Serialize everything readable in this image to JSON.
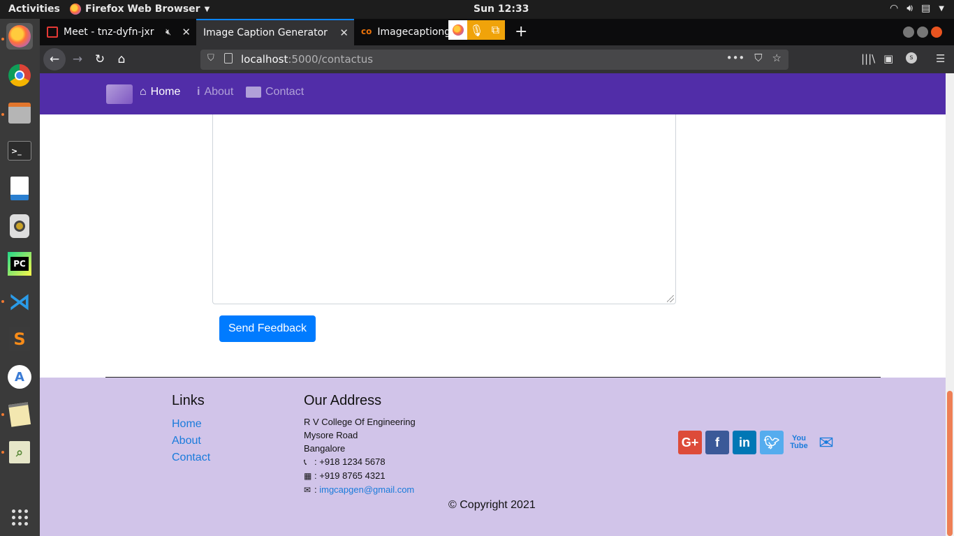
{
  "system": {
    "activities": "Activities",
    "app_menu": "Firefox Web Browser",
    "clock": "Sun 12:33"
  },
  "dock": {
    "items": [
      "firefox",
      "chrome",
      "files",
      "terminal",
      "libreoffice-writer",
      "rhythmbox",
      "pycharm",
      "vscode",
      "sublime-text",
      "android-studio",
      "text-editor",
      "gedit-tool",
      "show-applications"
    ],
    "pycharm_label": "PC"
  },
  "browser": {
    "tabs": [
      {
        "label": "Meet - tnz-dyfn-jxr"
      },
      {
        "label": "Image Caption Generator"
      },
      {
        "label": "Imagecaptionge"
      }
    ],
    "url_host": "localhost",
    "url_path": ":5000/contactus"
  },
  "site": {
    "nav": {
      "home": "Home",
      "about": "About",
      "contact": "Contact"
    },
    "send_button": "Send Feedback",
    "footer": {
      "links_heading": "Links",
      "links": [
        "Home",
        "About",
        "Contact"
      ],
      "address_heading": "Our Address",
      "address_lines": [
        "R V College Of Engineering",
        "Mysore Road",
        "Bangalore"
      ],
      "phone": ": +918 1234 5678",
      "fax": ": +919 8765 4321",
      "email_prefix": ": ",
      "email": "imgcapgen@gmail.com",
      "copyright": "© Copyright 2021",
      "social_icons": [
        "google-plus-icon",
        "facebook-icon",
        "linkedin-icon",
        "twitter-icon",
        "youtube-icon",
        "email-icon"
      ]
    }
  },
  "colors": {
    "site_nav": "#512da8",
    "footer_bg": "#d1c4e9",
    "primary_button": "#007bff",
    "google": "#dd4b39",
    "facebook": "#3b5998",
    "linkedin": "#0077b5",
    "twitter": "#55acee"
  }
}
